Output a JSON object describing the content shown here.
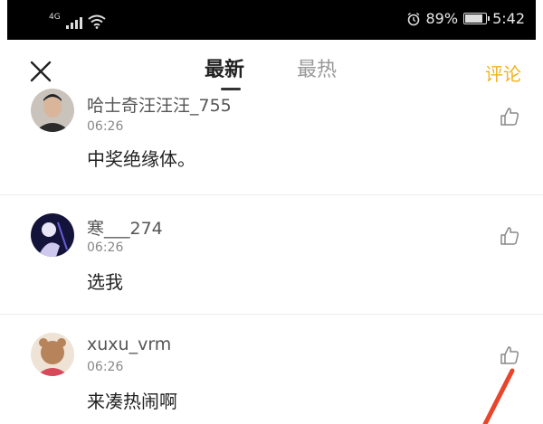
{
  "status_bar": {
    "network": "4G",
    "battery": "89%",
    "battery_level": 0.89,
    "time": "5:42",
    "icons": [
      "signal-icon",
      "wifi-icon",
      "alarm-icon",
      "battery-icon"
    ]
  },
  "header": {
    "tabs": [
      {
        "label": "最新",
        "active": true
      },
      {
        "label": "最热",
        "active": false
      }
    ],
    "comment_label": "评论",
    "accent_color": "#f2b21a"
  },
  "comments": [
    {
      "username": "哈士奇汪汪汪_755",
      "time": "06:26",
      "text": "中奖绝缘体。"
    },
    {
      "username": "寒___274",
      "time": "06:26",
      "text": "选我"
    },
    {
      "username": "xuxu_vrm",
      "time": "06:26",
      "text": "来凑热闹啊"
    }
  ]
}
